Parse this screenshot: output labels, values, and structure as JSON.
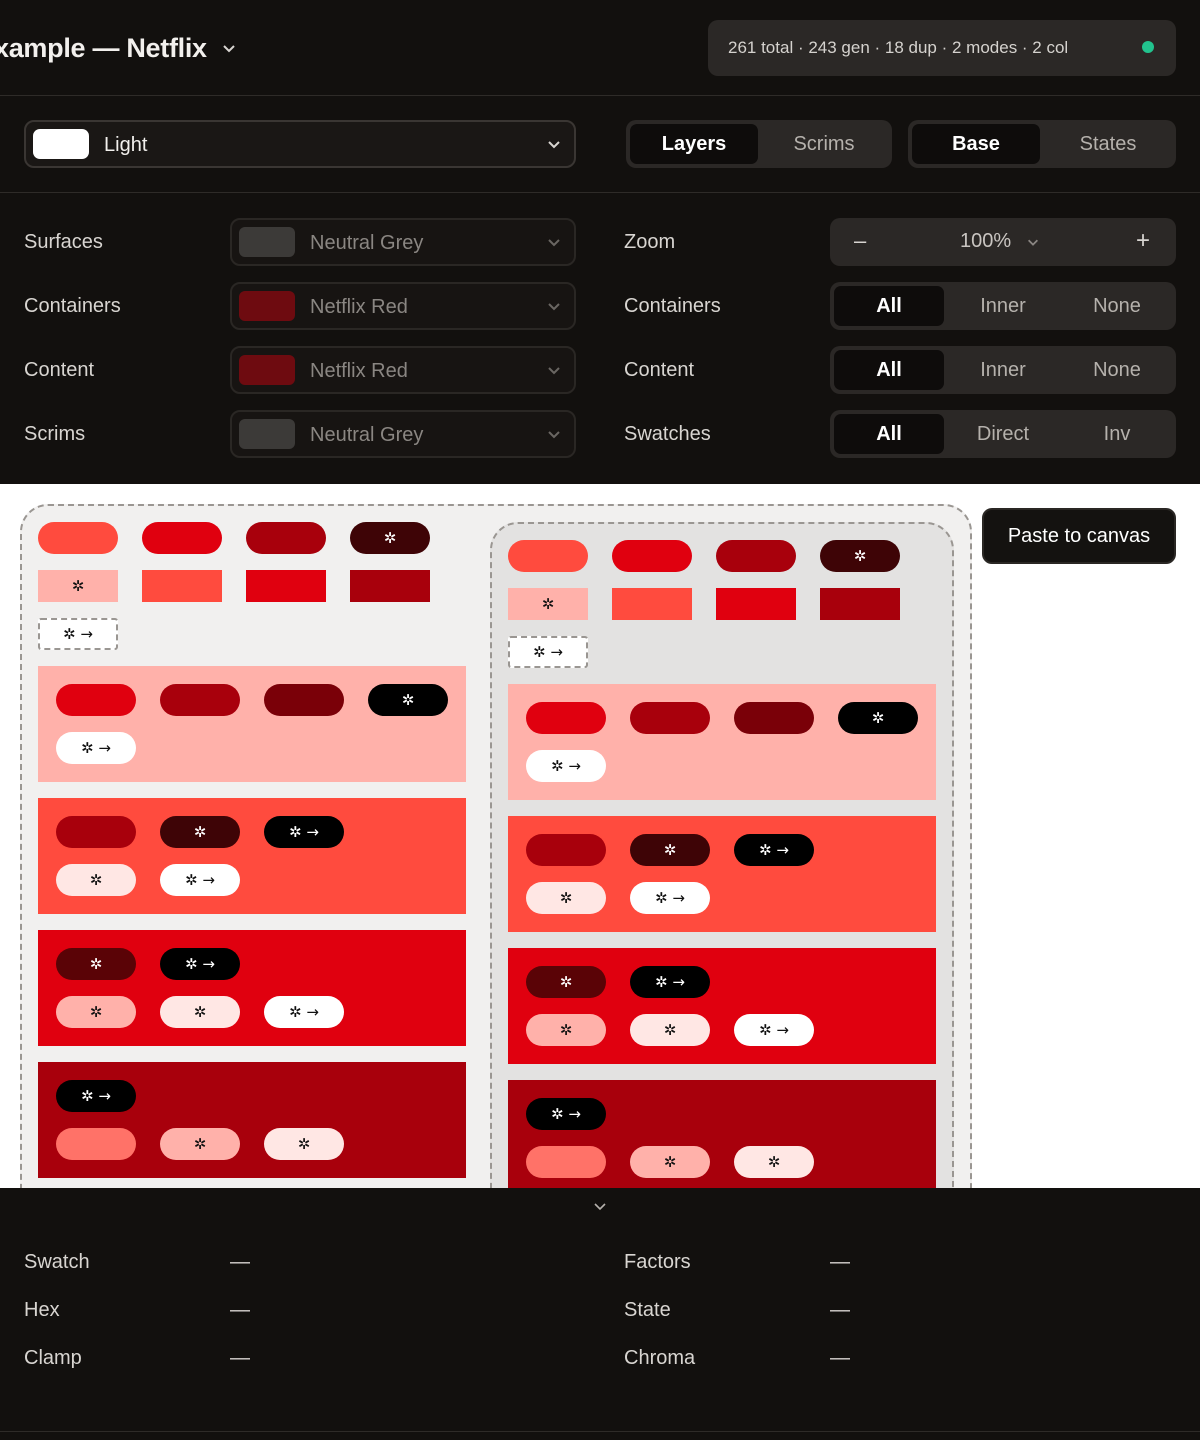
{
  "header": {
    "title": "xample — Netflix",
    "stats": "261 total · 243 gen · 18 dup · 2 modes · 2 col",
    "status_color": "#22c38e"
  },
  "toolbar": {
    "mode": {
      "label": "Light",
      "swatch": "#ffffff"
    },
    "view_tabs": [
      "Layers",
      "Scrims"
    ],
    "view_active": "Layers",
    "state_tabs": [
      "Base",
      "States"
    ],
    "state_active": "Base"
  },
  "settings": {
    "left": [
      {
        "label": "Surfaces",
        "value": "Neutral Grey",
        "swatch": "#3c3a38"
      },
      {
        "label": "Containers",
        "value": "Netflix Red",
        "swatch": "#6e0b10"
      },
      {
        "label": "Content",
        "value": "Netflix Red",
        "swatch": "#6e0b10"
      },
      {
        "label": "Scrims",
        "value": "Neutral Grey",
        "swatch": "#3c3a38"
      }
    ],
    "zoom": {
      "label": "Zoom",
      "minus": "–",
      "value": "100%",
      "plus": "+"
    },
    "right": [
      {
        "label": "Containers",
        "options": [
          "All",
          "Inner",
          "None"
        ],
        "active": "All"
      },
      {
        "label": "Content",
        "options": [
          "All",
          "Inner",
          "None"
        ],
        "active": "All"
      },
      {
        "label": "Swatches",
        "options": [
          "All",
          "Direct",
          "Inv"
        ],
        "active": "All"
      }
    ]
  },
  "canvas": {
    "paste_label": "Paste to canvas",
    "glyph_star": "✲",
    "glyph_arrow": "✲ →",
    "colors": {
      "red_300": "#ff4b3e",
      "red_500": "#e0000f",
      "red_600": "#a8000c",
      "red_700": "#7a0008",
      "red_900": "#3e0406",
      "pink_100": "#ffb1aa",
      "pink_50": "#ffe7e4",
      "salmon": "#ff7268",
      "black": "#000000",
      "white": "#ffffff",
      "frame_bg_left": "#f1f0ef",
      "frame_bg_right": "#e3e2e1"
    }
  },
  "inspector": {
    "left": [
      {
        "label": "Swatch",
        "value": "—"
      },
      {
        "label": "Hex",
        "value": "—"
      },
      {
        "label": "Clamp",
        "value": "—"
      }
    ],
    "right": [
      {
        "label": "Factors",
        "value": "—"
      },
      {
        "label": "State",
        "value": "—"
      },
      {
        "label": "Chroma",
        "value": "—"
      }
    ]
  }
}
